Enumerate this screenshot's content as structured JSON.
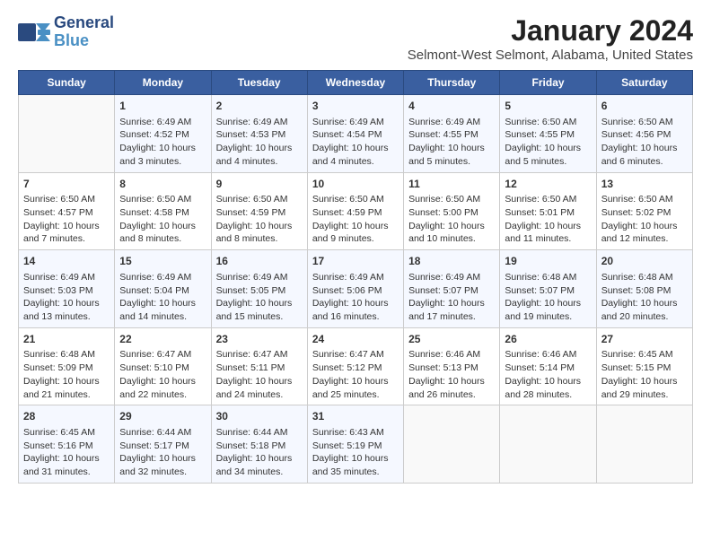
{
  "logo": {
    "line1": "General",
    "line2": "Blue"
  },
  "title": "January 2024",
  "subtitle": "Selmont-West Selmont, Alabama, United States",
  "days_of_week": [
    "Sunday",
    "Monday",
    "Tuesday",
    "Wednesday",
    "Thursday",
    "Friday",
    "Saturday"
  ],
  "weeks": [
    [
      {
        "day": "",
        "info": ""
      },
      {
        "day": "1",
        "info": "Sunrise: 6:49 AM\nSunset: 4:52 PM\nDaylight: 10 hours\nand 3 minutes."
      },
      {
        "day": "2",
        "info": "Sunrise: 6:49 AM\nSunset: 4:53 PM\nDaylight: 10 hours\nand 4 minutes."
      },
      {
        "day": "3",
        "info": "Sunrise: 6:49 AM\nSunset: 4:54 PM\nDaylight: 10 hours\nand 4 minutes."
      },
      {
        "day": "4",
        "info": "Sunrise: 6:49 AM\nSunset: 4:55 PM\nDaylight: 10 hours\nand 5 minutes."
      },
      {
        "day": "5",
        "info": "Sunrise: 6:50 AM\nSunset: 4:55 PM\nDaylight: 10 hours\nand 5 minutes."
      },
      {
        "day": "6",
        "info": "Sunrise: 6:50 AM\nSunset: 4:56 PM\nDaylight: 10 hours\nand 6 minutes."
      }
    ],
    [
      {
        "day": "7",
        "info": "Sunrise: 6:50 AM\nSunset: 4:57 PM\nDaylight: 10 hours\nand 7 minutes."
      },
      {
        "day": "8",
        "info": "Sunrise: 6:50 AM\nSunset: 4:58 PM\nDaylight: 10 hours\nand 8 minutes."
      },
      {
        "day": "9",
        "info": "Sunrise: 6:50 AM\nSunset: 4:59 PM\nDaylight: 10 hours\nand 8 minutes."
      },
      {
        "day": "10",
        "info": "Sunrise: 6:50 AM\nSunset: 4:59 PM\nDaylight: 10 hours\nand 9 minutes."
      },
      {
        "day": "11",
        "info": "Sunrise: 6:50 AM\nSunset: 5:00 PM\nDaylight: 10 hours\nand 10 minutes."
      },
      {
        "day": "12",
        "info": "Sunrise: 6:50 AM\nSunset: 5:01 PM\nDaylight: 10 hours\nand 11 minutes."
      },
      {
        "day": "13",
        "info": "Sunrise: 6:50 AM\nSunset: 5:02 PM\nDaylight: 10 hours\nand 12 minutes."
      }
    ],
    [
      {
        "day": "14",
        "info": "Sunrise: 6:49 AM\nSunset: 5:03 PM\nDaylight: 10 hours\nand 13 minutes."
      },
      {
        "day": "15",
        "info": "Sunrise: 6:49 AM\nSunset: 5:04 PM\nDaylight: 10 hours\nand 14 minutes."
      },
      {
        "day": "16",
        "info": "Sunrise: 6:49 AM\nSunset: 5:05 PM\nDaylight: 10 hours\nand 15 minutes."
      },
      {
        "day": "17",
        "info": "Sunrise: 6:49 AM\nSunset: 5:06 PM\nDaylight: 10 hours\nand 16 minutes."
      },
      {
        "day": "18",
        "info": "Sunrise: 6:49 AM\nSunset: 5:07 PM\nDaylight: 10 hours\nand 17 minutes."
      },
      {
        "day": "19",
        "info": "Sunrise: 6:48 AM\nSunset: 5:07 PM\nDaylight: 10 hours\nand 19 minutes."
      },
      {
        "day": "20",
        "info": "Sunrise: 6:48 AM\nSunset: 5:08 PM\nDaylight: 10 hours\nand 20 minutes."
      }
    ],
    [
      {
        "day": "21",
        "info": "Sunrise: 6:48 AM\nSunset: 5:09 PM\nDaylight: 10 hours\nand 21 minutes."
      },
      {
        "day": "22",
        "info": "Sunrise: 6:47 AM\nSunset: 5:10 PM\nDaylight: 10 hours\nand 22 minutes."
      },
      {
        "day": "23",
        "info": "Sunrise: 6:47 AM\nSunset: 5:11 PM\nDaylight: 10 hours\nand 24 minutes."
      },
      {
        "day": "24",
        "info": "Sunrise: 6:47 AM\nSunset: 5:12 PM\nDaylight: 10 hours\nand 25 minutes."
      },
      {
        "day": "25",
        "info": "Sunrise: 6:46 AM\nSunset: 5:13 PM\nDaylight: 10 hours\nand 26 minutes."
      },
      {
        "day": "26",
        "info": "Sunrise: 6:46 AM\nSunset: 5:14 PM\nDaylight: 10 hours\nand 28 minutes."
      },
      {
        "day": "27",
        "info": "Sunrise: 6:45 AM\nSunset: 5:15 PM\nDaylight: 10 hours\nand 29 minutes."
      }
    ],
    [
      {
        "day": "28",
        "info": "Sunrise: 6:45 AM\nSunset: 5:16 PM\nDaylight: 10 hours\nand 31 minutes."
      },
      {
        "day": "29",
        "info": "Sunrise: 6:44 AM\nSunset: 5:17 PM\nDaylight: 10 hours\nand 32 minutes."
      },
      {
        "day": "30",
        "info": "Sunrise: 6:44 AM\nSunset: 5:18 PM\nDaylight: 10 hours\nand 34 minutes."
      },
      {
        "day": "31",
        "info": "Sunrise: 6:43 AM\nSunset: 5:19 PM\nDaylight: 10 hours\nand 35 minutes."
      },
      {
        "day": "",
        "info": ""
      },
      {
        "day": "",
        "info": ""
      },
      {
        "day": "",
        "info": ""
      }
    ]
  ]
}
